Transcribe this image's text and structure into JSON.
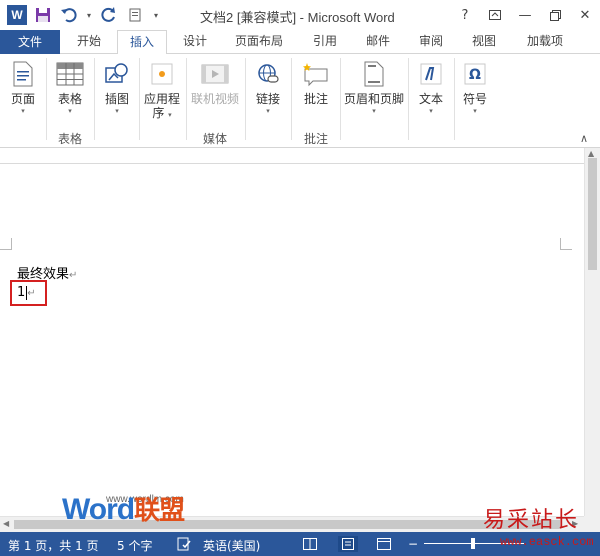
{
  "window": {
    "title": "文档2 [兼容模式] - Microsoft Word",
    "controls": {
      "help": "?",
      "minimize": "—",
      "close": "✕"
    }
  },
  "qat": {
    "logo": "W"
  },
  "tabs": [
    "文件",
    "开始",
    "插入",
    "设计",
    "页面布局",
    "引用",
    "邮件",
    "审阅",
    "视图",
    "加载项"
  ],
  "active_tab": "插入",
  "ribbon": {
    "buttons": {
      "page": "页面",
      "table": "表格",
      "illustration": "插图",
      "apps_line1": "应用程",
      "apps_line2": "序",
      "online_video": "联机视频",
      "links": "链接",
      "comment": "批注",
      "header_footer": "页眉和页脚",
      "text": "文本",
      "symbols": "符号"
    },
    "groups": {
      "table": "表格",
      "media": "媒体",
      "comments": "批注"
    }
  },
  "document": {
    "line1": "最终效果",
    "line2": "1"
  },
  "watermark": {
    "word": "Word",
    "cn": "联盟",
    "url": "www.wordlm.com",
    "right": "易采站长站",
    "right_url": "www.easck.com"
  },
  "status": {
    "page": "第 1 页，共 1 页",
    "words": "5 个字",
    "language": "英语(美国)"
  },
  "colors": {
    "accent": "#2b579a",
    "highlight": "#d42020"
  }
}
